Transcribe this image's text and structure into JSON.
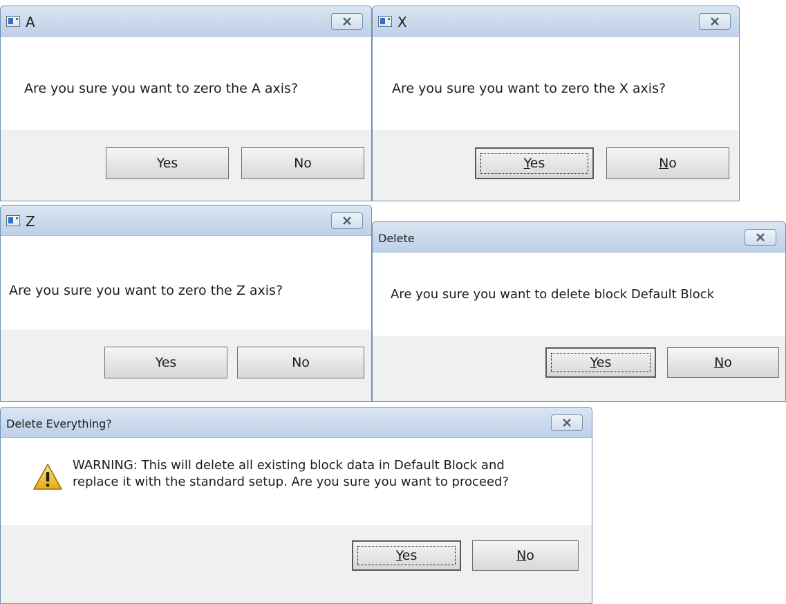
{
  "dialogs": {
    "a": {
      "title": "A",
      "message": "Are you sure you want to zero the A axis?",
      "yes_label": "Yes",
      "no_label": "No"
    },
    "x": {
      "title": "X",
      "message": "Are you sure you want to zero the X axis?",
      "yes_mnemonic": "Y",
      "yes_rest": "es",
      "no_mnemonic": "N",
      "no_rest": "o"
    },
    "z": {
      "title": "Z",
      "message": "Are you sure you want to zero the Z axis?",
      "yes_label": "Yes",
      "no_label": "No"
    },
    "delete": {
      "title": "Delete",
      "message": "Are you sure you want to delete block Default Block",
      "yes_mnemonic": "Y",
      "yes_rest": "es",
      "no_mnemonic": "N",
      "no_rest": "o"
    },
    "delete_everything": {
      "title": "Delete Everything?",
      "message_line1": "WARNING: This will delete all existing block data in Default Block and",
      "message_line2": "replace it with the standard setup. Are you sure you want to proceed?",
      "yes_mnemonic": "Y",
      "yes_rest": "es",
      "no_mnemonic": "N",
      "no_rest": "o"
    }
  },
  "icons": {
    "close": "close-x-icon",
    "app": "app-window-icon",
    "warning": "warning-triangle-icon"
  },
  "colors": {
    "titlebar": "#cbdaec",
    "footer": "#f0f0f0",
    "warning": "#f3c21b"
  }
}
